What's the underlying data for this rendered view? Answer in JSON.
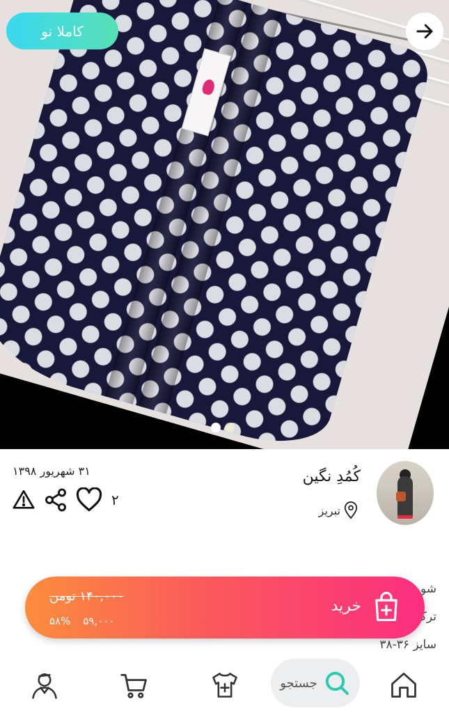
{
  "product": {
    "badge": "کاملا نو",
    "image_count": 2,
    "active_image_index": 1
  },
  "seller": {
    "name": "کُمُدِ نگین",
    "city": "تبریز"
  },
  "meta": {
    "date": "۳۱ شهریور ۱۳۹۸",
    "likes": "۲"
  },
  "description": {
    "line1": "شو",
    "line2": "ترک",
    "line3": "سایز ۳۶-۳۸"
  },
  "buy_bar": {
    "label": "خرید",
    "original_price": "۱۴۰,۰۰۰ تومن",
    "price": "۵۹,۰۰۰",
    "discount": "۵۸%"
  },
  "bottom_nav": {
    "search_label": "جستجو"
  },
  "colors": {
    "badge_gradient": [
      "#3ad8f0",
      "#57e0b6"
    ],
    "buy_gradient": [
      "#fb8d3c",
      "#fb5a5b",
      "#fb2e80"
    ],
    "search_accent": "#2bcbb3"
  },
  "icons": [
    "arrow-right-icon",
    "location-pin-icon",
    "heart-icon",
    "share-icon",
    "warning-icon",
    "shopping-bag-add-icon",
    "home-icon",
    "search-icon",
    "add-clothing-icon",
    "cart-icon",
    "profile-icon"
  ]
}
